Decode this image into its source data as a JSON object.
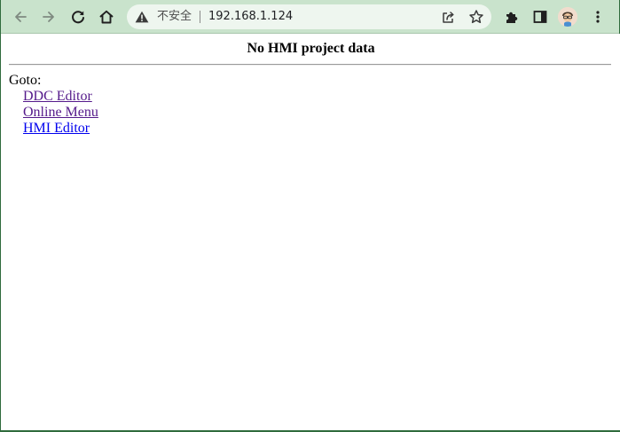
{
  "browser": {
    "address_bar": {
      "security_label": "不安全",
      "url": "192.168.1.124"
    },
    "colors": {
      "toolbar": "#c9e3cc",
      "omnibox": "#eef6ef",
      "frame": "#2f6b3c"
    }
  },
  "page": {
    "title": "No HMI project data",
    "goto_label": "Goto:",
    "links": [
      {
        "label": "DDC Editor",
        "visited": true
      },
      {
        "label": "Online Menu",
        "visited": true
      },
      {
        "label": "HMI Editor",
        "visited": false
      }
    ],
    "colors": {
      "visited_link": "#551a8b",
      "unvisited_link": "#0000ee"
    }
  },
  "icons": [
    "back-arrow-icon",
    "forward-arrow-icon",
    "reload-icon",
    "home-icon",
    "warning-icon",
    "share-icon",
    "bookmark-star-icon",
    "extensions-puzzle-icon",
    "side-panel-icon",
    "profile-avatar-icon",
    "more-menu-icon"
  ]
}
